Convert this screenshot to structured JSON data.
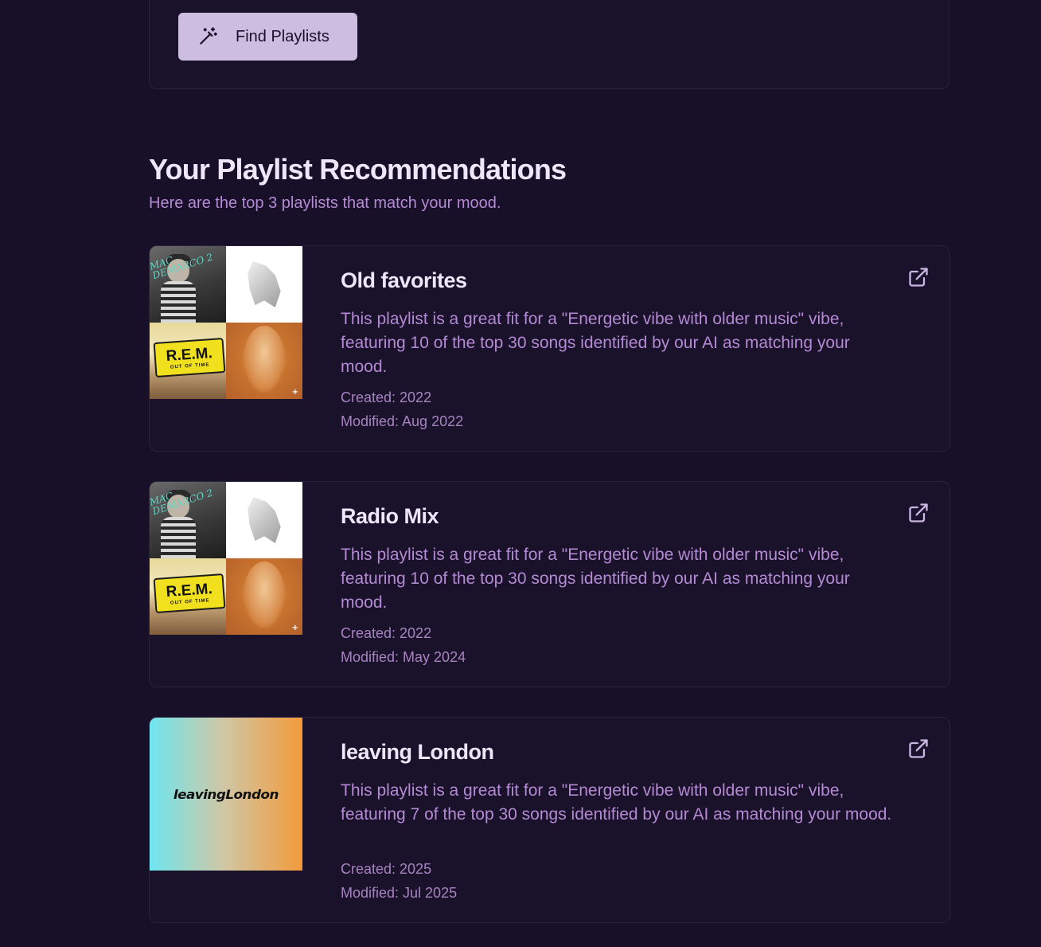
{
  "search": {
    "find_button_label": "Find Playlists"
  },
  "section": {
    "title": "Your Playlist Recommendations",
    "subtitle": "Here are the top 3 playlists that match your mood."
  },
  "playlists": [
    {
      "title": "Old favorites",
      "description": "This playlist is a great fit for a \"Energetic vibe with older music\" vibe, featuring 10 of the top 30 songs identified by our AI as matching your mood.",
      "created": "Created: 2022",
      "modified": "Modified: Aug 2022",
      "cover": {
        "tiles": [
          "mac-demarco-2-cover",
          "coldplay-cover",
          "rem-out-of-time-cover",
          "ed-sheeran-plus-cover"
        ],
        "texts": {
          "mac": "MAC DEMARCO 2",
          "rem": "R.E.M.",
          "rem_sub": "OUT OF TIME",
          "plus": "+"
        }
      }
    },
    {
      "title": "Radio Mix",
      "description": "This playlist is a great fit for a \"Energetic vibe with older music\" vibe, featuring 10 of the top 30 songs identified by our AI as matching your mood.",
      "created": "Created: 2022",
      "modified": "Modified: May 2024",
      "cover": {
        "tiles": [
          "mac-demarco-2-cover",
          "coldplay-cover",
          "rem-out-of-time-cover",
          "ed-sheeran-plus-cover"
        ],
        "texts": {
          "mac": "MAC DEMARCO 2",
          "rem": "R.E.M.",
          "rem_sub": "OUT OF TIME",
          "plus": "+"
        }
      }
    },
    {
      "title": "leaving London",
      "description": "This playlist is a great fit for a \"Energetic vibe with older music\" vibe, featuring 7 of the top 30 songs identified by our AI as matching your mood.",
      "created": "Created: 2025",
      "modified": "Modified: Jul 2025",
      "cover": {
        "text": "leavingLondon"
      }
    }
  ],
  "icons": {
    "find_button": "magic-wand-icon",
    "open_link": "external-link-icon"
  },
  "colors": {
    "background": "#180f28",
    "card": "#1a112b",
    "button": "#cdbde0",
    "title": "#efe6fa",
    "accent_text": "#b58ad4"
  }
}
